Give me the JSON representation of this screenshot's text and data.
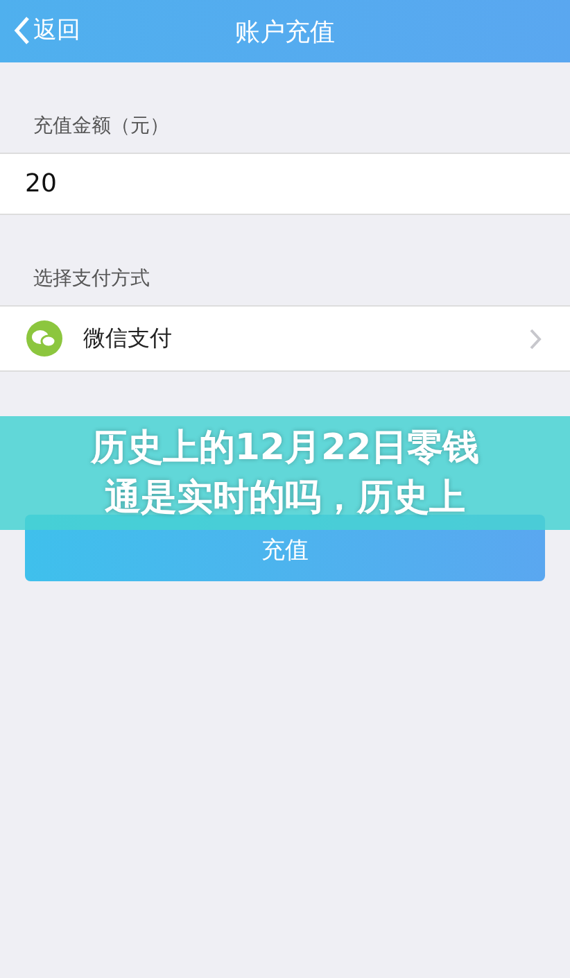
{
  "nav_bar": {
    "back": "返回",
    "title": "账户充值"
  },
  "amount": {
    "label": "充值金额（元）",
    "value": "20"
  },
  "payment": {
    "label": "选择支付方式",
    "method": "微信支付"
  },
  "submit_button": "充值",
  "headline_banner": {
    "lines": [
      "历史上的12月22日零钱",
      "通是实时的吗，历史上"
    ]
  }
}
